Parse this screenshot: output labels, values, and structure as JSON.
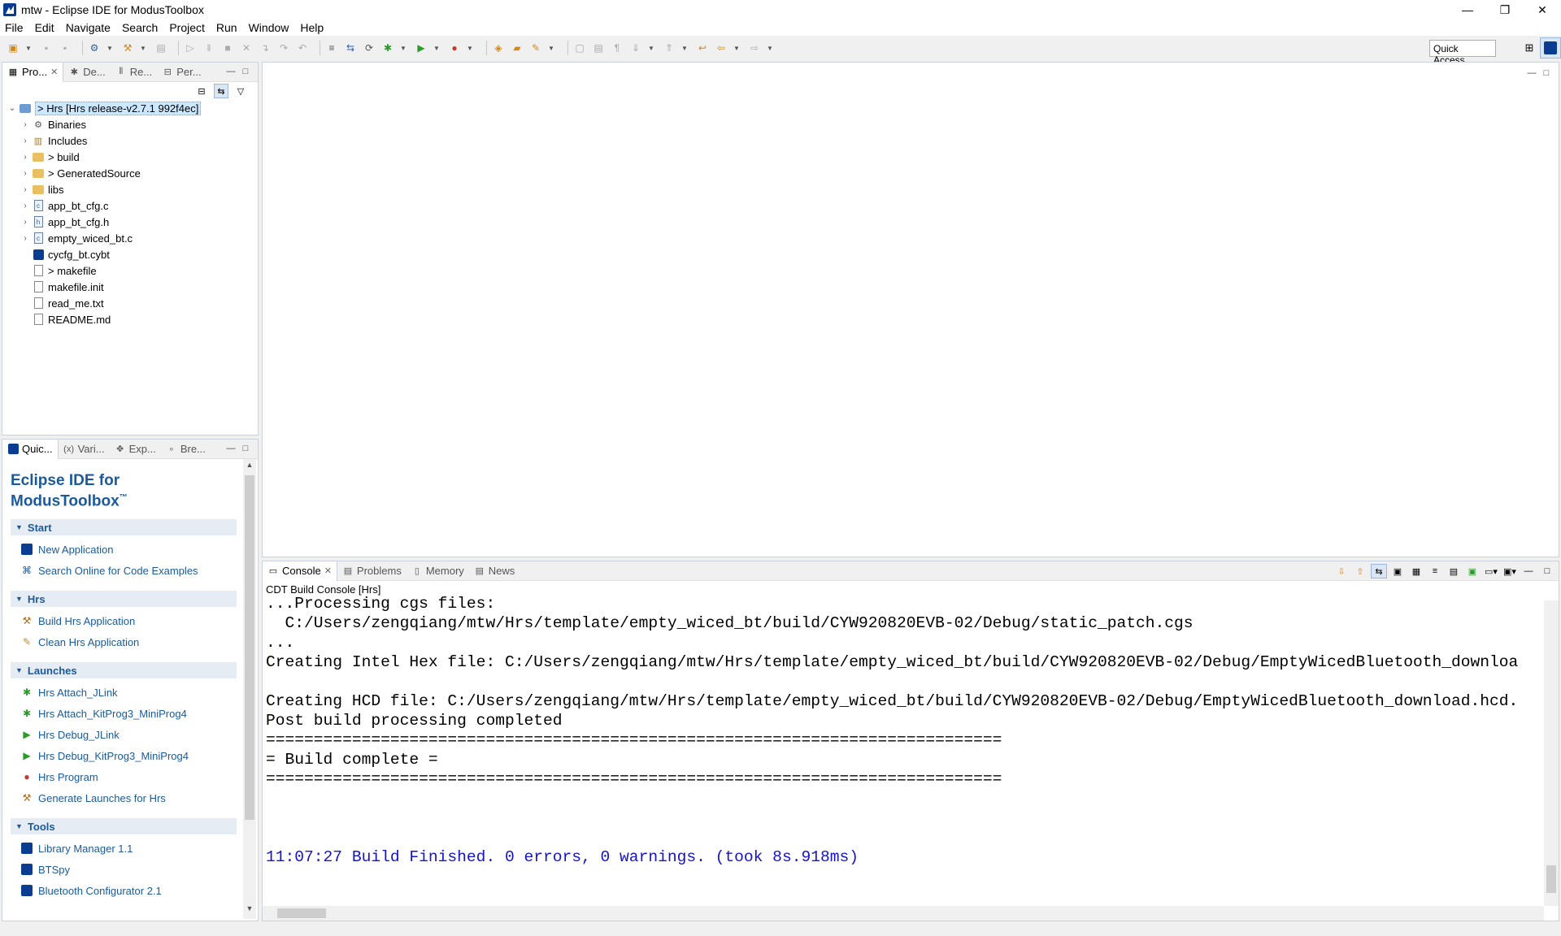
{
  "window": {
    "title": "mtw - Eclipse IDE for ModusToolbox",
    "controls": [
      "—",
      "❐",
      "✕"
    ]
  },
  "menu": [
    "File",
    "Edit",
    "Navigate",
    "Search",
    "Project",
    "Run",
    "Window",
    "Help"
  ],
  "toolbar": {
    "quick_access": "Quick Access"
  },
  "explorer": {
    "tabs": [
      {
        "label": "Pro...",
        "icon": "project-explorer-icon"
      },
      {
        "label": "De...",
        "icon": "debug-icon"
      },
      {
        "label": "Re...",
        "icon": "registers-icon"
      },
      {
        "label": "Per...",
        "icon": "peripherals-icon"
      }
    ],
    "root": "> Hrs [Hrs release-v2.7.1 992f4ec]",
    "items": [
      {
        "label": "Binaries",
        "expandable": true,
        "icon": "binaries-icon"
      },
      {
        "label": "Includes",
        "expandable": true,
        "icon": "includes-icon"
      },
      {
        "label": "> build",
        "expandable": true,
        "icon": "folder-icon"
      },
      {
        "label": "> GeneratedSource",
        "expandable": true,
        "icon": "folder-icon"
      },
      {
        "label": "libs",
        "expandable": true,
        "icon": "folder-icon"
      },
      {
        "label": "app_bt_cfg.c",
        "expandable": true,
        "icon": "c-file-icon"
      },
      {
        "label": "app_bt_cfg.h",
        "expandable": true,
        "icon": "h-file-icon"
      },
      {
        "label": "empty_wiced_bt.c",
        "expandable": true,
        "icon": "c-file-icon"
      },
      {
        "label": "cycfg_bt.cybt",
        "expandable": false,
        "icon": "cybt-file-icon"
      },
      {
        "label": "> makefile",
        "expandable": false,
        "icon": "makefile-icon"
      },
      {
        "label": "makefile.init",
        "expandable": false,
        "icon": "file-icon"
      },
      {
        "label": "read_me.txt",
        "expandable": false,
        "icon": "file-icon"
      },
      {
        "label": "README.md",
        "expandable": false,
        "icon": "file-icon"
      }
    ]
  },
  "quick_panel": {
    "tabs": [
      {
        "label": "Quic...",
        "icon": "quick-panel-icon"
      },
      {
        "label": "Vari...",
        "icon": "variables-icon"
      },
      {
        "label": "Exp...",
        "icon": "expressions-icon"
      },
      {
        "label": "Bre...",
        "icon": "breakpoints-icon"
      }
    ],
    "title_line1": "Eclipse IDE for",
    "title_line2": "ModusToolbox",
    "trademark": "™",
    "sections": [
      {
        "name": "Start",
        "items": [
          {
            "label": "New Application",
            "icon": "modustoolbox-icon"
          },
          {
            "label": "Search Online for Code Examples",
            "icon": "link-icon"
          }
        ]
      },
      {
        "name": "Hrs",
        "items": [
          {
            "label": "Build Hrs Application",
            "icon": "hammer-icon"
          },
          {
            "label": "Clean Hrs Application",
            "icon": "broom-icon"
          }
        ]
      },
      {
        "name": "Launches",
        "items": [
          {
            "label": "Hrs Attach_JLink",
            "icon": "attach-icon"
          },
          {
            "label": "Hrs Attach_KitProg3_MiniProg4",
            "icon": "attach-icon"
          },
          {
            "label": "Hrs Debug_JLink",
            "icon": "debug-run-icon"
          },
          {
            "label": "Hrs Debug_KitProg3_MiniProg4",
            "icon": "debug-run-icon"
          },
          {
            "label": "Hrs Program",
            "icon": "program-icon"
          },
          {
            "label": "Generate Launches for Hrs",
            "icon": "hammer-icon"
          }
        ]
      },
      {
        "name": "Tools",
        "items": [
          {
            "label": "Library Manager 1.1",
            "icon": "modustoolbox-icon"
          },
          {
            "label": "BTSpy",
            "icon": "modustoolbox-icon"
          },
          {
            "label": "Bluetooth Configurator 2.1",
            "icon": "modustoolbox-icon"
          }
        ]
      }
    ]
  },
  "console": {
    "tabs": [
      {
        "label": "Console",
        "icon": "console-icon"
      },
      {
        "label": "Problems",
        "icon": "problems-icon"
      },
      {
        "label": "Memory",
        "icon": "memory-icon"
      },
      {
        "label": "News",
        "icon": "news-icon"
      }
    ],
    "label": "CDT Build Console [Hrs]",
    "lines": [
      {
        "text": "...Processing cgs files:",
        "color": "black"
      },
      {
        "text": "  C:/Users/zengqiang/mtw/Hrs/template/empty_wiced_bt/build/CYW920820EVB-02/Debug/static_patch.cgs",
        "color": "black"
      },
      {
        "text": "...",
        "color": "black"
      },
      {
        "text": "Creating Intel Hex file: C:/Users/zengqiang/mtw/Hrs/template/empty_wiced_bt/build/CYW920820EVB-02/Debug/EmptyWicedBluetooth_downloa",
        "color": "black"
      },
      {
        "text": "",
        "color": "black"
      },
      {
        "text": "Creating HCD file: C:/Users/zengqiang/mtw/Hrs/template/empty_wiced_bt/build/CYW920820EVB-02/Debug/EmptyWicedBluetooth_download.hcd.",
        "color": "black"
      },
      {
        "text": "Post build processing completed",
        "color": "black"
      },
      {
        "text": "=============================================================================",
        "color": "black"
      },
      {
        "text": "= Build complete =",
        "color": "black"
      },
      {
        "text": "=============================================================================",
        "color": "black"
      },
      {
        "text": "",
        "color": "black"
      },
      {
        "text": "",
        "color": "black"
      },
      {
        "text": "",
        "color": "black"
      },
      {
        "text": "11:07:27 Build Finished. 0 errors, 0 warnings. (took 8s.918ms)",
        "color": "blue"
      }
    ]
  }
}
